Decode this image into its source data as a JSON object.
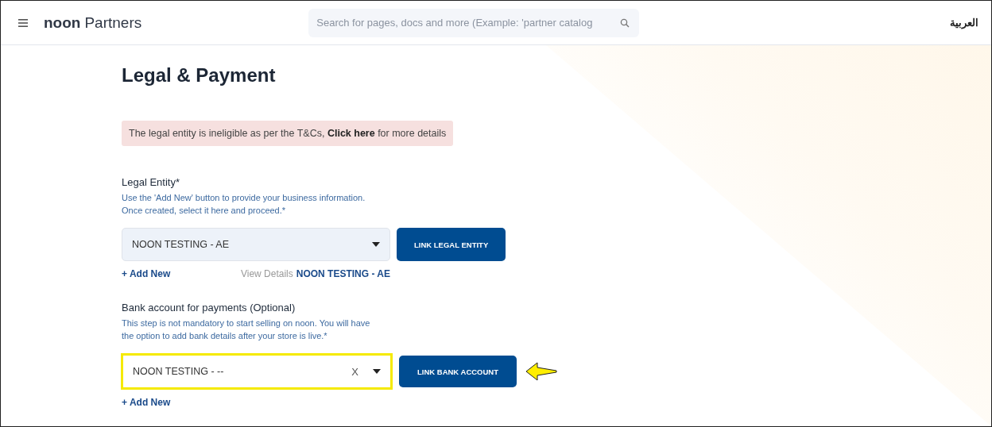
{
  "header": {
    "logo_bold": "noon",
    "logo_rest": "Partners",
    "search": {
      "placeholder": "Search for pages, docs and more (Example: 'partner catalog"
    },
    "language": "العربية"
  },
  "page": {
    "title": "Legal & Payment",
    "alert": {
      "before": "The legal entity is ineligible as per the T&Cs, ",
      "link": "Click here",
      "after": " for more details"
    },
    "sections": [
      {
        "label": "Legal Entity*",
        "help": [
          "Use the 'Add New' button to provide your business information.",
          "Once created, select it here and proceed.*"
        ],
        "select": {
          "value": "NOON TESTING - AE",
          "highlighted": false
        },
        "button": "LINK LEGAL ENTITY",
        "add_new": "+ Add New",
        "details": {
          "label": "View Details",
          "value": "NOON TESTING - AE"
        }
      },
      {
        "label": "Bank account for payments (Optional)",
        "help": [
          "This step is not mandatory to start selling on noon. You will have",
          "the option to add bank details after your store is live.*"
        ],
        "select": {
          "value": "NOON TESTING - --",
          "clear_symbol": "X",
          "highlighted": true
        },
        "button": "LINK BANK ACCOUNT",
        "add_new": "+ Add New"
      }
    ]
  }
}
